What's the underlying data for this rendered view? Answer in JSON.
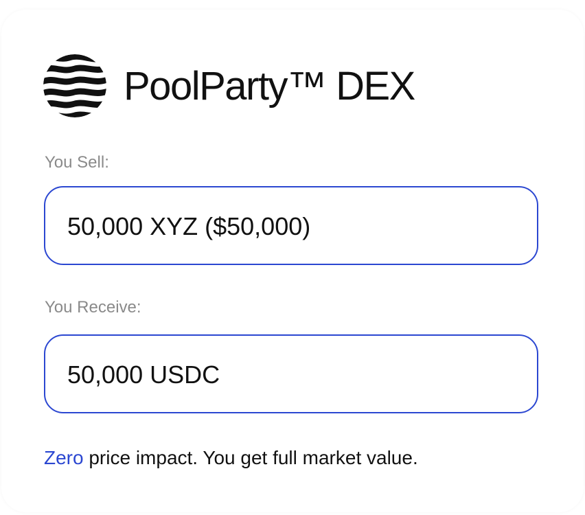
{
  "app": {
    "name": "PoolParty™ DEX",
    "logo_icon": "wave-sphere-icon"
  },
  "sell": {
    "label": "You Sell:",
    "value": "50,000 XYZ ($50,000)"
  },
  "receive": {
    "label": "You Receive:",
    "value": "50,000 USDC"
  },
  "note": {
    "highlight": "Zero",
    "text": " price impact. You get full market value."
  },
  "colors": {
    "accent": "#2b47d1",
    "text": "#111111",
    "muted_label": "#8a8a8a"
  }
}
